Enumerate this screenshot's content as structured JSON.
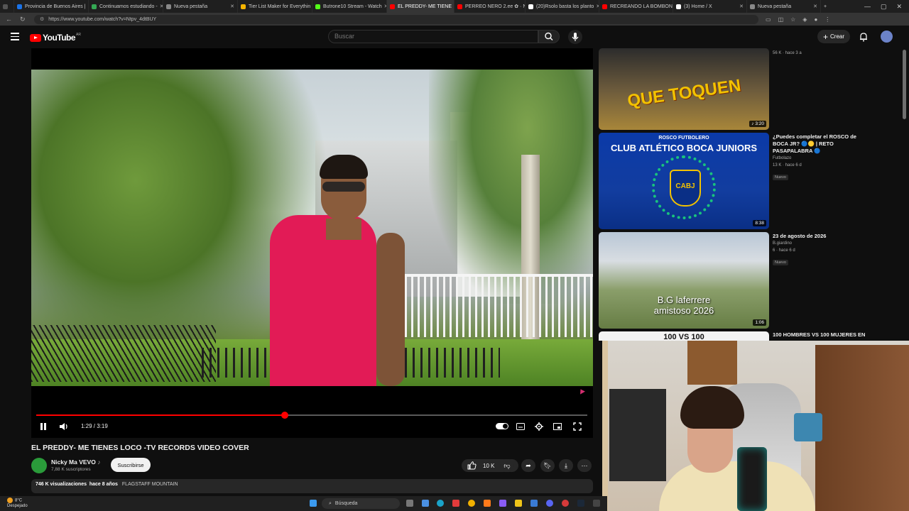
{
  "browser": {
    "tabs": [
      {
        "label": "Provincia de Buenos Aires |",
        "color": "#1a73e8",
        "active": false
      },
      {
        "label": "Continuamos estudiando -",
        "color": "#34a853",
        "active": false
      },
      {
        "label": "Nueva pestaña",
        "color": "#888888",
        "active": false
      },
      {
        "label": "Tier List Maker for Everythin",
        "color": "#f4b400",
        "active": false
      },
      {
        "label": "Butrone10 Stream - Watch",
        "color": "#53fc18",
        "active": false
      },
      {
        "label": "EL PREDDY- ME TIENE",
        "color": "#ff0000",
        "active": true
      },
      {
        "label": "PERREO NERO 2.ee ✿ · N",
        "color": "#ff0000",
        "active": false
      },
      {
        "label": "(20)Rsolo basta los planto",
        "color": "#ffffff",
        "active": false
      },
      {
        "label": "RECREANDO LA BOMBON",
        "color": "#ff0000",
        "active": false
      },
      {
        "label": "(3) Home / X",
        "color": "#ffffff",
        "active": false
      },
      {
        "label": "Nueva pestaña",
        "color": "#888888",
        "active": false
      }
    ],
    "new_tab": "+",
    "url": "https://www.youtube.com/watch?v=Ntpv_4dtBUY"
  },
  "header": {
    "logo_text": "YouTube",
    "country": "AR",
    "search_placeholder": "Buscar",
    "create_label": "Crear"
  },
  "player": {
    "time": "1:29 / 3:19",
    "progress": 0.451,
    "state": "playing"
  },
  "video": {
    "title": "EL PREDDY- ME TIENES LOCO -TV RECORDS VIDEO COVER",
    "channel": "Nicky Ma VEVO",
    "channel_badge": "♪",
    "subscribers": "7,88 K suscriptores",
    "subscribe_label": "Suscribirse",
    "likes": "10 K",
    "views": "746 K visualizaciones",
    "age": "hace 8 años",
    "tag": "FLAGSTAFF MOUNTAIN"
  },
  "recommendations": [
    {
      "thumb_text": "QUE TOQUEN",
      "duration": "3:20",
      "title": "",
      "channel": "",
      "stats": "56 K · hace 3 a",
      "badge": ""
    },
    {
      "thumb_text": "CLUB ATLÉTICO BOCA JUNIORS",
      "thumb_sub": "ROSCO FUTBOLERO",
      "thumb_crest": "CABJ",
      "duration": "8:38",
      "title": "¿Puedes completar el ROSCO de BOCA JR? 🔵🟡 | RETO PASAPALABRA 🔵",
      "channel": "Futbolazo",
      "stats": "13 K · hace 6 d",
      "badge": "Nuevo"
    },
    {
      "thumb_text": "B.G laferrere amistoso 2026",
      "duration": "1:06",
      "title": "23 de agosto de 2026",
      "channel": "B.giardino",
      "stats": "6 · hace 6 d",
      "badge": "Nuevo"
    },
    {
      "thumb_text": "100 VS 100",
      "duration": "",
      "title": "100 HOMBRES VS 100 MUJERES EN",
      "channel": "",
      "stats": "",
      "badge": ""
    }
  ],
  "taskbar": {
    "weather_temp": "8°C",
    "weather_text": "Despejado",
    "search_label": "Búsqueda"
  }
}
